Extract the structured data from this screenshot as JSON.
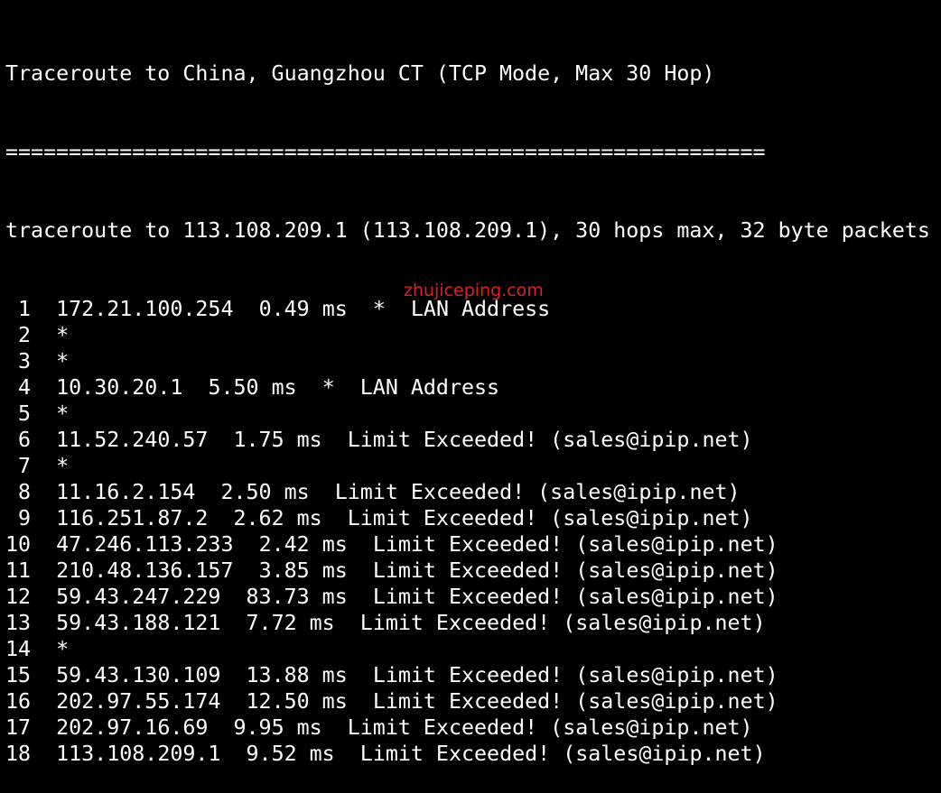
{
  "terminal": {
    "title_line": "Traceroute to China, Guangzhou CT (TCP Mode, Max 30 Hop)",
    "separator": "============================================================",
    "command_line": "traceroute to 113.108.209.1 (113.108.209.1), 30 hops max, 32 byte packets",
    "hops": [
      {
        "num": " 1",
        "ip": "172.21.100.254",
        "rtt": "0.49 ms",
        "extra": "*  LAN Address"
      },
      {
        "num": " 2",
        "ip": "*",
        "rtt": "",
        "extra": ""
      },
      {
        "num": " 3",
        "ip": "*",
        "rtt": "",
        "extra": ""
      },
      {
        "num": " 4",
        "ip": "10.30.20.1",
        "rtt": "5.50 ms",
        "extra": "*  LAN Address"
      },
      {
        "num": " 5",
        "ip": "*",
        "rtt": "",
        "extra": ""
      },
      {
        "num": " 6",
        "ip": "11.52.240.57",
        "rtt": "1.75 ms",
        "extra": "Limit Exceeded! (sales@ipip.net)"
      },
      {
        "num": " 7",
        "ip": "*",
        "rtt": "",
        "extra": ""
      },
      {
        "num": " 8",
        "ip": "11.16.2.154",
        "rtt": "2.50 ms",
        "extra": "Limit Exceeded! (sales@ipip.net)"
      },
      {
        "num": " 9",
        "ip": "116.251.87.2",
        "rtt": "2.62 ms",
        "extra": "Limit Exceeded! (sales@ipip.net)"
      },
      {
        "num": "10",
        "ip": "47.246.113.233",
        "rtt": "2.42 ms",
        "extra": "Limit Exceeded! (sales@ipip.net)"
      },
      {
        "num": "11",
        "ip": "210.48.136.157",
        "rtt": "3.85 ms",
        "extra": "Limit Exceeded! (sales@ipip.net)"
      },
      {
        "num": "12",
        "ip": "59.43.247.229",
        "rtt": "83.73 ms",
        "extra": "Limit Exceeded! (sales@ipip.net)"
      },
      {
        "num": "13",
        "ip": "59.43.188.121",
        "rtt": "7.72 ms",
        "extra": "Limit Exceeded! (sales@ipip.net)"
      },
      {
        "num": "14",
        "ip": "*",
        "rtt": "",
        "extra": ""
      },
      {
        "num": "15",
        "ip": "59.43.130.109",
        "rtt": "13.88 ms",
        "extra": "Limit Exceeded! (sales@ipip.net)"
      },
      {
        "num": "16",
        "ip": "202.97.55.174",
        "rtt": "12.50 ms",
        "extra": "Limit Exceeded! (sales@ipip.net)"
      },
      {
        "num": "17",
        "ip": "202.97.16.69",
        "rtt": "9.95 ms",
        "extra": "Limit Exceeded! (sales@ipip.net)"
      },
      {
        "num": "18",
        "ip": "113.108.209.1",
        "rtt": "9.52 ms",
        "extra": "Limit Exceeded! (sales@ipip.net)"
      }
    ]
  },
  "watermark": {
    "text": "zhujiceping.com"
  },
  "colors": {
    "background": "#000000",
    "foreground": "#ffffff",
    "watermark": "#ff2a2a"
  }
}
